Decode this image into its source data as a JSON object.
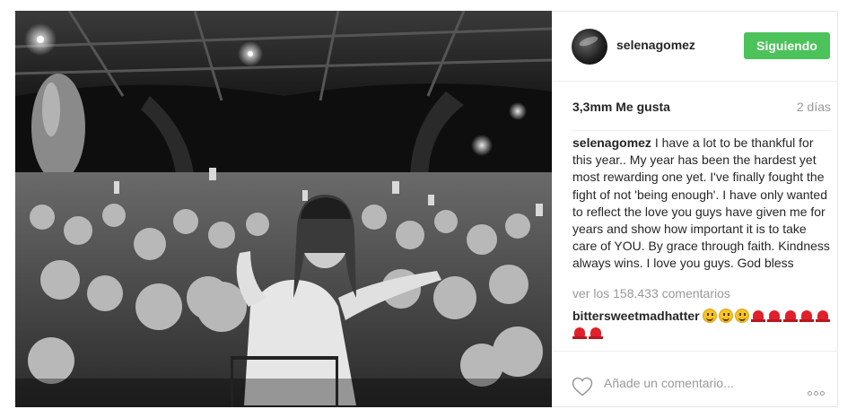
{
  "post": {
    "image_alt": "Black and white photo of a woman surrounded by a large crowd of fans at night under a bridge"
  },
  "header": {
    "username": "selenagomez",
    "follow_label": "Siguiendo"
  },
  "stats": {
    "likes": "3,3mm Me gusta",
    "time": "2 días"
  },
  "caption": {
    "author": "selenagomez",
    "text": " I have a lot to be thankful for this year.. My year has been the hardest yet most rewarding one yet. I've finally fought the fight of not 'being enough'. I have only wanted to reflect the love you guys have given me for years and show how important it is to take care of YOU. By grace through faith. Kindness always wins. I love you guys. God bless"
  },
  "comments": {
    "view_all": "ver los 158.433 comentarios",
    "items": [
      {
        "author": "bittersweetmadhatter",
        "emojis": [
          "smile",
          "smile",
          "smile",
          "siren",
          "siren",
          "siren",
          "siren",
          "siren",
          "siren",
          "siren"
        ]
      }
    ]
  },
  "footer": {
    "comment_placeholder": "Añade un comentario..."
  },
  "colors": {
    "follow_button": "#4cc35a",
    "text_primary": "#262626",
    "text_secondary": "#999999"
  }
}
